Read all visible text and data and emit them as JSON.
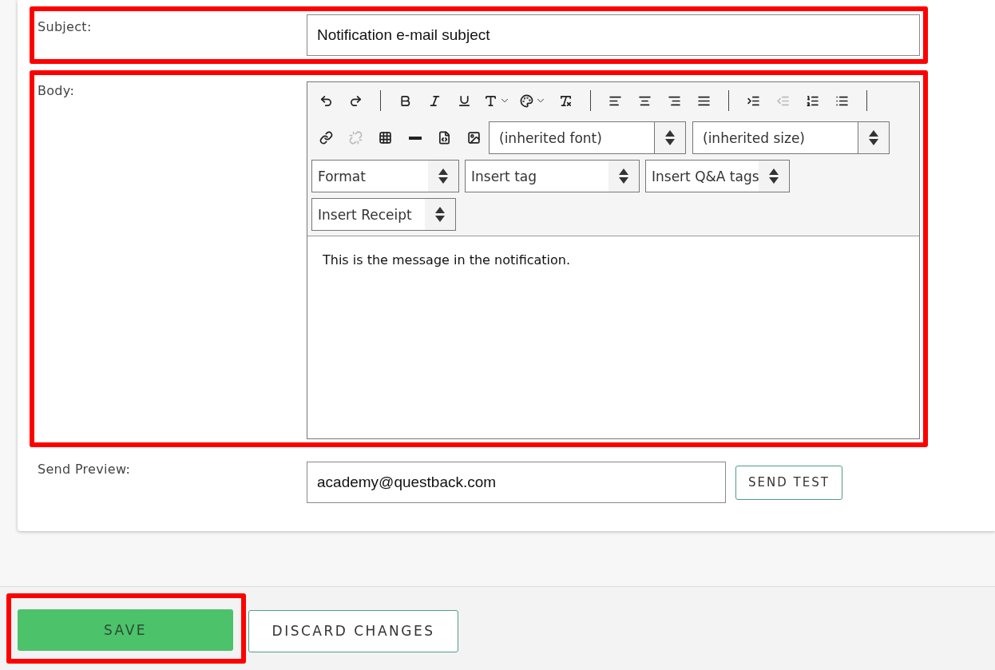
{
  "subject": {
    "label": "Subject:",
    "value": "Notification e-mail subject",
    "highlighted": true
  },
  "body": {
    "label": "Body:",
    "highlighted": true,
    "toolbar": [
      [
        {
          "kind": "button",
          "disabled": false
        },
        {
          "kind": "button",
          "disabled": false
        },
        {
          "kind": "separator"
        },
        {
          "kind": "button",
          "disabled": false
        },
        {
          "kind": "button",
          "disabled": false
        },
        {
          "kind": "button",
          "disabled": false
        },
        {
          "kind": "dropdown",
          "disabled": false
        },
        {
          "kind": "dropdown",
          "disabled": false
        },
        {
          "kind": "button",
          "disabled": false
        },
        {
          "kind": "separator"
        },
        {
          "kind": "button",
          "disabled": false
        },
        {
          "kind": "button",
          "disabled": false
        },
        {
          "kind": "button",
          "disabled": false
        },
        {
          "kind": "button",
          "disabled": false
        },
        {
          "kind": "separator"
        },
        {
          "kind": "button",
          "disabled": false
        },
        {
          "kind": "button",
          "disabled": true
        },
        {
          "kind": "button",
          "disabled": false
        },
        {
          "kind": "button",
          "disabled": false
        },
        {
          "kind": "separator"
        }
      ],
      [
        {
          "kind": "button",
          "disabled": false
        },
        {
          "kind": "button",
          "disabled": true
        },
        {
          "kind": "button",
          "disabled": false
        },
        {
          "kind": "button",
          "disabled": false
        },
        {
          "kind": "button",
          "disabled": false
        },
        {
          "kind": "button",
          "disabled": false
        },
        {
          "kind": "combo",
          "label": "(inherited font)"
        },
        {
          "kind": "combo",
          "label": "(inherited size)"
        }
      ],
      [
        {
          "kind": "select",
          "label": "Format"
        },
        {
          "kind": "select",
          "label": "Insert tag"
        },
        {
          "kind": "select",
          "label": "Insert Q&A tags"
        }
      ],
      [
        {
          "kind": "select",
          "label": "Insert Receipt"
        }
      ]
    ],
    "content": "This is the message in the notification."
  },
  "send_preview": {
    "label": "Send Preview:",
    "value": "academy@questback.com",
    "button": "SEND TEST",
    "highlighted": false
  },
  "footer": {
    "save": {
      "label": "SAVE",
      "highlighted": true
    },
    "discard": {
      "label": "DISCARD CHANGES"
    }
  }
}
